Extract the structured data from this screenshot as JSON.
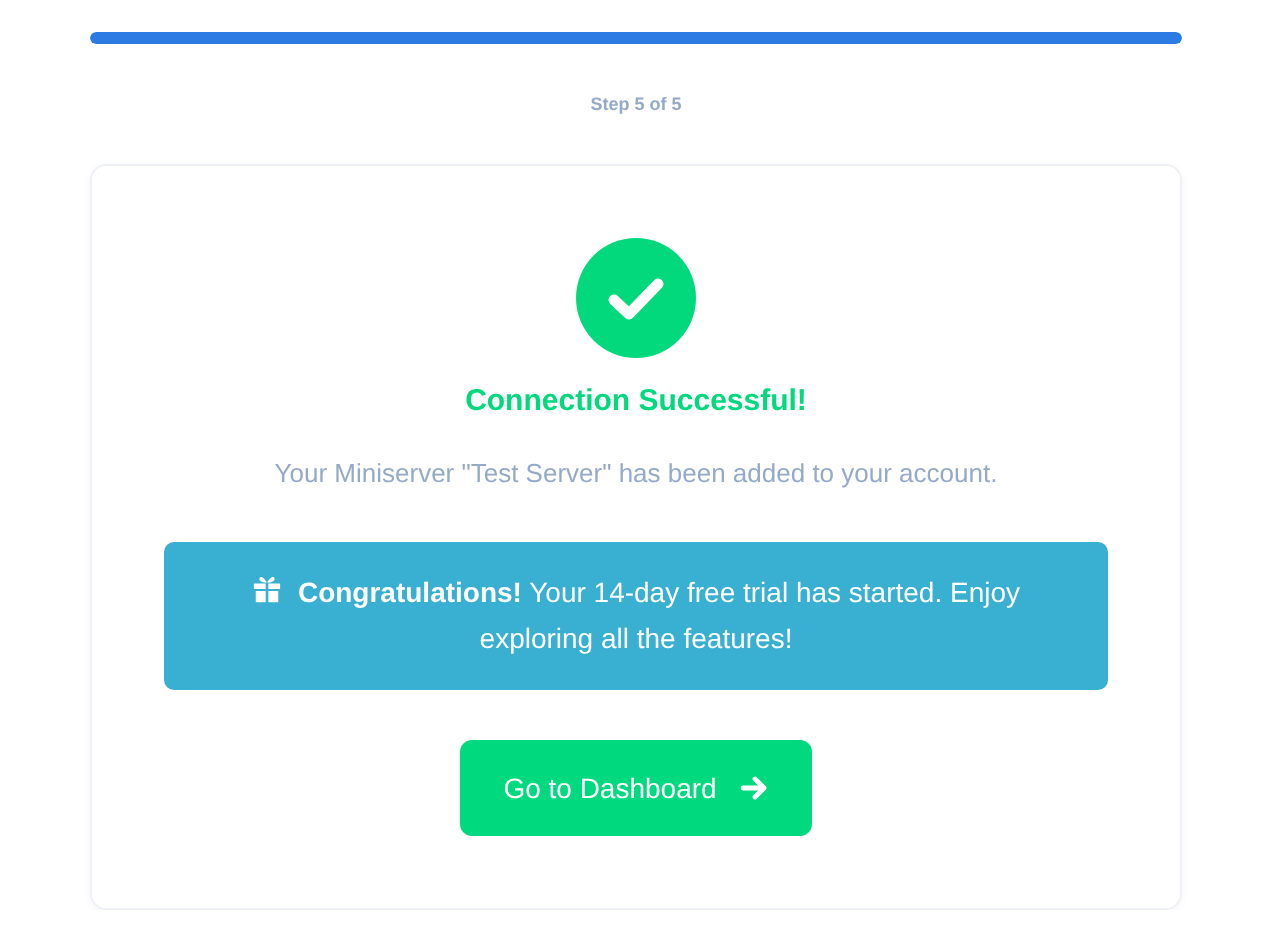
{
  "progress": {
    "level": 1.0,
    "label": "Step 5 of 5"
  },
  "result": {
    "title": "Connection Successful!",
    "message": "Your Miniserver \"Test Server\" has been added to your account."
  },
  "notice": {
    "text": "**Congratulations!** Your 14-day free trial has started. Enjoy exploring all the features!"
  },
  "button": {
    "label": "Go to Dashboard"
  }
}
